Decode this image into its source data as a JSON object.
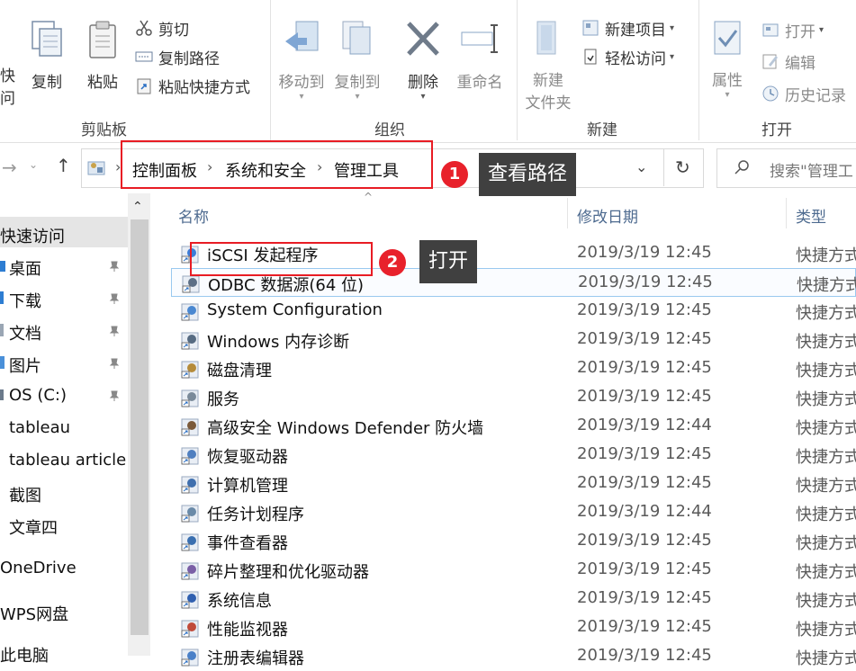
{
  "ribbon": {
    "clipboard": {
      "cut_partial_line1": "快",
      "cut_partial_line2": "问",
      "copy": "复制",
      "paste": "粘贴",
      "cut": "剪切",
      "copy_path": "复制路径",
      "paste_shortcut": "粘贴快捷方式",
      "group_label": "剪贴板"
    },
    "organize": {
      "move_to": "移动到",
      "copy_to": "复制到",
      "delete": "删除",
      "rename": "重命名",
      "group_label": "组织"
    },
    "new": {
      "new_folder_line1": "新建",
      "new_folder_line2": "文件夹",
      "new_item": "新建项目",
      "easy_access": "轻松访问",
      "group_label": "新建"
    },
    "open": {
      "properties": "属性",
      "open": "打开",
      "edit": "编辑",
      "history": "历史记录",
      "group_label": "打开"
    }
  },
  "address": {
    "crumbs": [
      "控制面板",
      "系统和安全",
      "管理工具"
    ],
    "search_placeholder": "搜索\"管理工"
  },
  "sidebar": {
    "items": [
      {
        "label": "快速访问",
        "icon": "star-icon"
      },
      {
        "label": "桌面",
        "icon": "desktop-icon"
      },
      {
        "label": "下载",
        "icon": "download-icon"
      },
      {
        "label": "文档",
        "icon": "documents-icon"
      },
      {
        "label": "图片",
        "icon": "pictures-icon"
      },
      {
        "label": "OS (C:)",
        "icon": "drive-icon"
      },
      {
        "label": "tableau",
        "icon": "folder-icon"
      },
      {
        "label": "tableau article",
        "icon": "folder-icon"
      },
      {
        "label": "截图",
        "icon": "folder-icon"
      },
      {
        "label": "文章四",
        "icon": "folder-icon"
      },
      {
        "label": "OneDrive",
        "icon": "cloud-icon"
      },
      {
        "label": "WPS网盘",
        "icon": "cloud-icon"
      },
      {
        "label": "此电脑",
        "icon": "computer-icon"
      }
    ]
  },
  "columns": {
    "name": "名称",
    "date": "修改日期",
    "type": "类型"
  },
  "files": [
    {
      "name": "iSCSI 发起程序",
      "date": "2019/3/19 12:45",
      "type": "快捷方式"
    },
    {
      "name": "ODBC 数据源(64 位)",
      "date": "2019/3/19 12:45",
      "type": "快捷方式"
    },
    {
      "name": "System Configuration",
      "date": "2019/3/19 12:45",
      "type": "快捷方式"
    },
    {
      "name": "Windows 内存诊断",
      "date": "2019/3/19 12:45",
      "type": "快捷方式"
    },
    {
      "name": "磁盘清理",
      "date": "2019/3/19 12:45",
      "type": "快捷方式"
    },
    {
      "name": "服务",
      "date": "2019/3/19 12:45",
      "type": "快捷方式"
    },
    {
      "name": "高级安全 Windows Defender 防火墙",
      "date": "2019/3/19 12:44",
      "type": "快捷方式"
    },
    {
      "name": "恢复驱动器",
      "date": "2019/3/19 12:45",
      "type": "快捷方式"
    },
    {
      "name": "计算机管理",
      "date": "2019/3/19 12:45",
      "type": "快捷方式"
    },
    {
      "name": "任务计划程序",
      "date": "2019/3/19 12:44",
      "type": "快捷方式"
    },
    {
      "name": "事件查看器",
      "date": "2019/3/19 12:45",
      "type": "快捷方式"
    },
    {
      "name": "碎片整理和优化驱动器",
      "date": "2019/3/19 12:45",
      "type": "快捷方式"
    },
    {
      "name": "系统信息",
      "date": "2019/3/19 12:45",
      "type": "快捷方式"
    },
    {
      "name": "性能监视器",
      "date": "2019/3/19 12:45",
      "type": "快捷方式"
    },
    {
      "name": "注册表编辑器",
      "date": "2019/3/19 12:45",
      "type": "快捷方式"
    }
  ],
  "annotations": {
    "step1_number": "1",
    "step1_text": "查看路径",
    "step2_number": "2",
    "step2_text": "打开"
  },
  "colors": {
    "accent": "#e81c24",
    "callout_bg": "#404040",
    "selection_border": "#99c9ef"
  }
}
